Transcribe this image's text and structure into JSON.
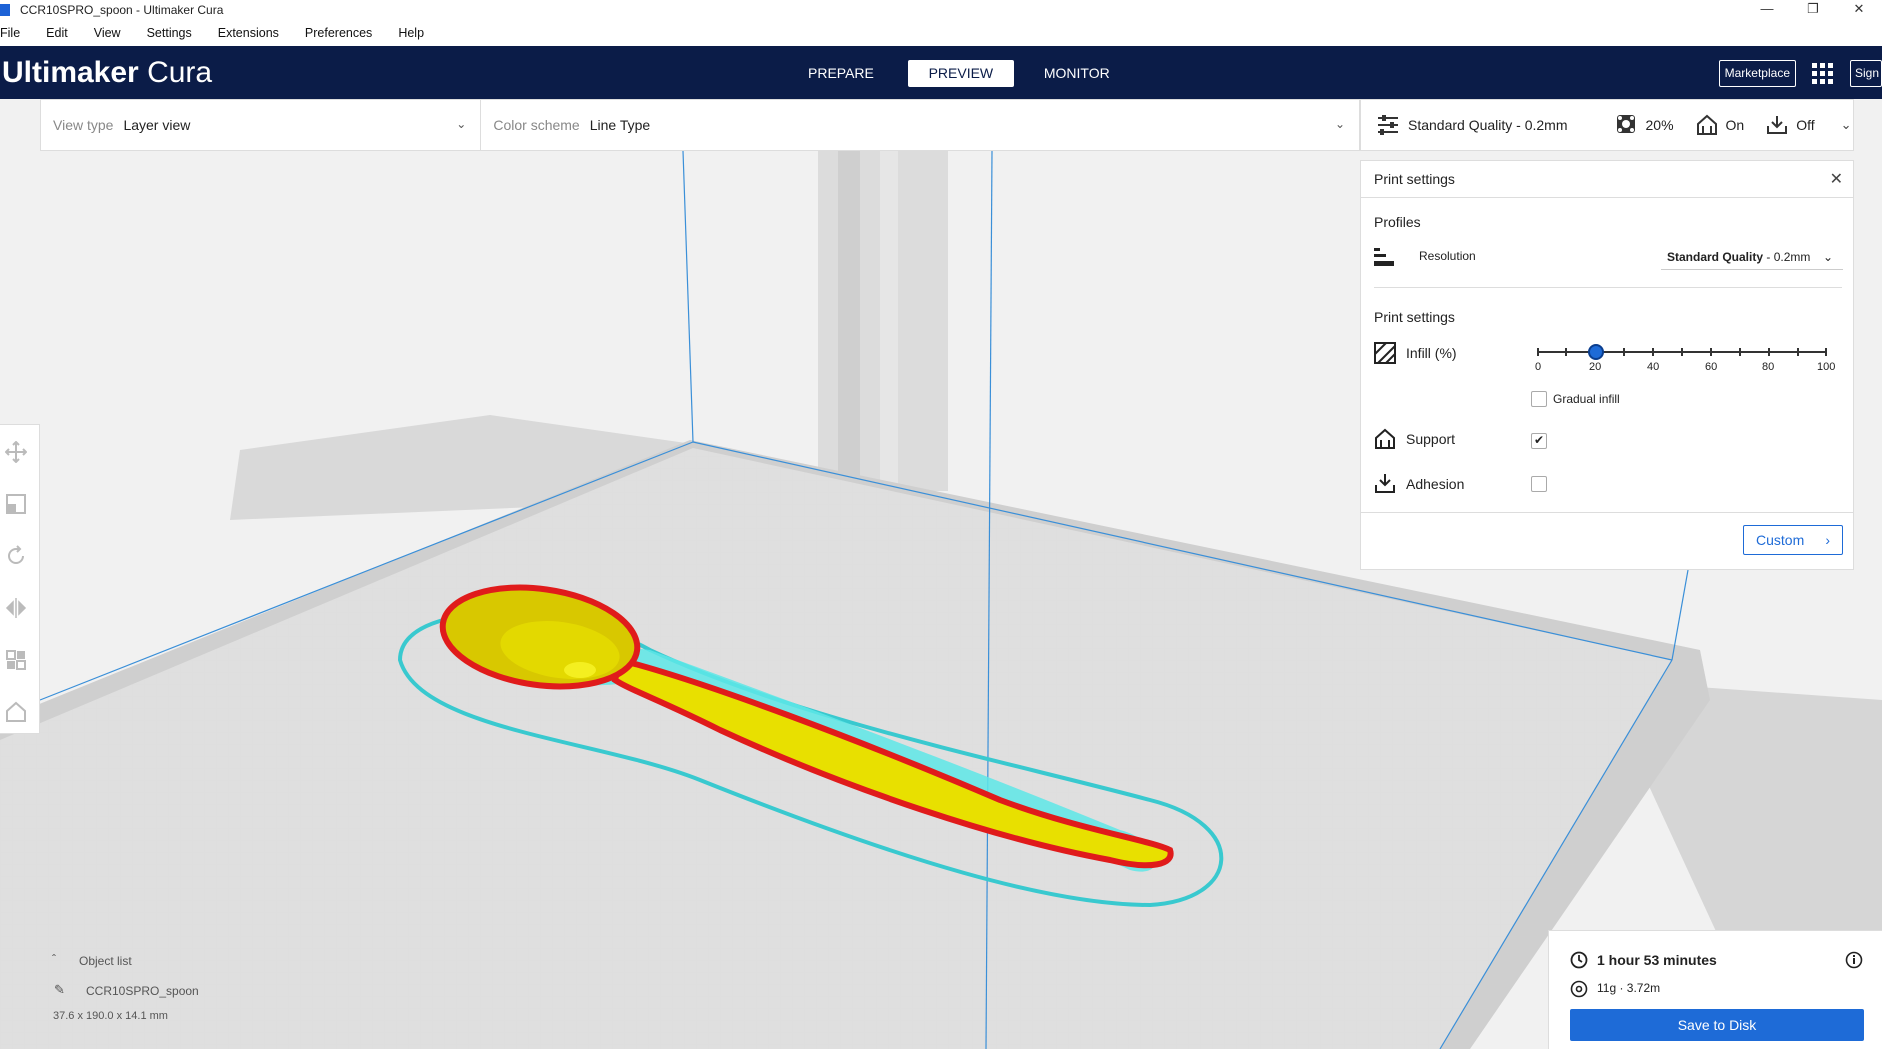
{
  "window": {
    "title": "CCR10SPRO_spoon - Ultimaker Cura",
    "minimize": "—",
    "restore": "❐",
    "close": "✕"
  },
  "menu": [
    "File",
    "Edit",
    "View",
    "Settings",
    "Extensions",
    "Preferences",
    "Help"
  ],
  "header": {
    "logo_bold": "Ultimaker",
    "logo_light": "Cura",
    "stages": [
      "PREPARE",
      "PREVIEW",
      "MONITOR"
    ],
    "active_stage": "PREVIEW",
    "marketplace": "Marketplace",
    "sign_in": "Sign in"
  },
  "viewbar": {
    "view_type_label": "View type",
    "view_type_value": "Layer view",
    "color_scheme_label": "Color scheme",
    "color_scheme_value": "Line Type"
  },
  "printbar": {
    "quality": "Standard Quality - 0.2mm",
    "infill": "20%",
    "support": "On",
    "adhesion": "Off"
  },
  "print_settings": {
    "title": "Print settings",
    "profiles_title": "Profiles",
    "resolution_label": "Resolution",
    "resolution_bold": "Standard Quality",
    "resolution_rest": " - 0.2mm",
    "section_title": "Print settings",
    "infill_label": "Infill (%)",
    "infill_value": 20,
    "infill_ticks": [
      "0",
      "20",
      "40",
      "60",
      "80",
      "100"
    ],
    "gradual_infill_label": "Gradual infill",
    "gradual_infill_checked": false,
    "support_label": "Support",
    "support_checked": true,
    "adhesion_label": "Adhesion",
    "adhesion_checked": false,
    "custom_button": "Custom"
  },
  "object_list": {
    "header": "Object list",
    "item": "CCR10SPRO_spoon",
    "dimensions": "37.6 x 190.0 x 14.1 mm"
  },
  "summary": {
    "time": "1 hour 53 minutes",
    "material": "11g · 3.72m",
    "save_button": "Save to Disk"
  },
  "colors": {
    "header_bg": "#0b1c48",
    "accent": "#1e6bd7",
    "spoon_wall": "#e01b1b",
    "spoon_skin": "#e8e000",
    "support": "#5ee8e8"
  }
}
